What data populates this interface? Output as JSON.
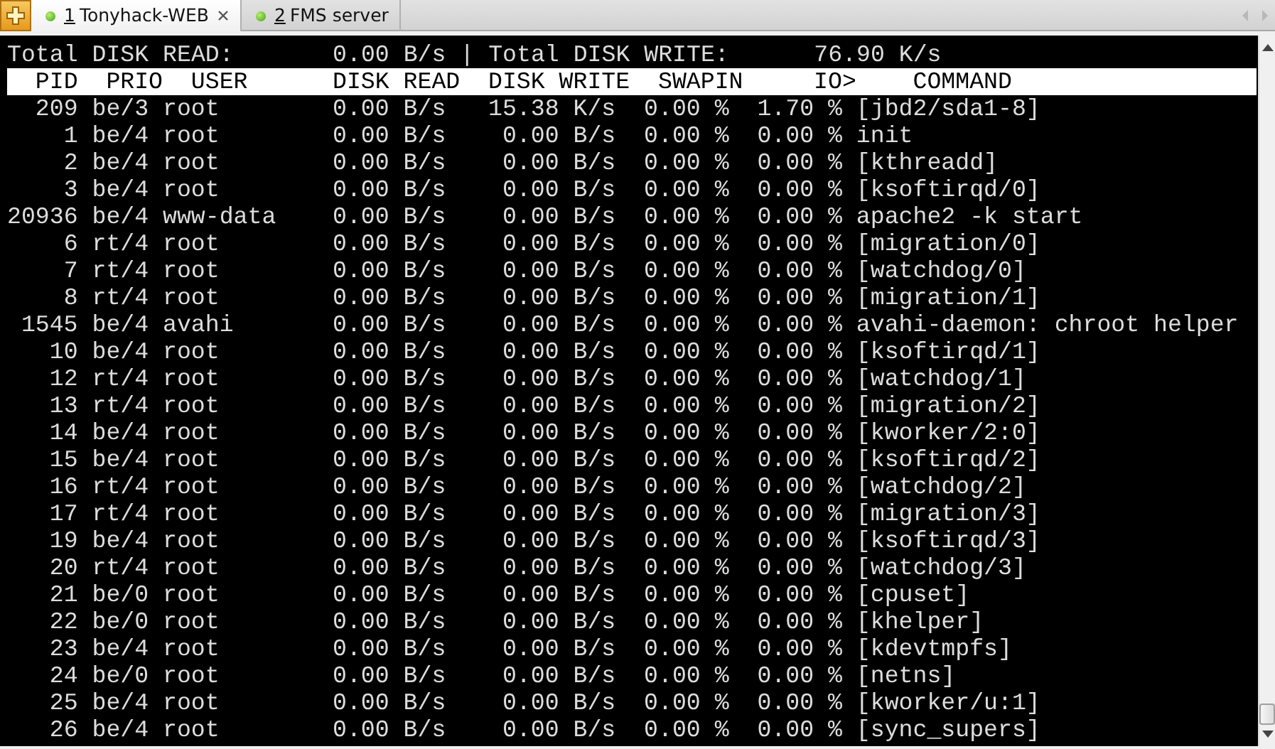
{
  "tabs": [
    {
      "number": "1",
      "label": "Tonyhack-WEB",
      "selected": true
    },
    {
      "number": "2",
      "label": "FMS server",
      "selected": false
    }
  ],
  "summary": {
    "read_label": "Total DISK READ:",
    "read_value": "0.00 B/s",
    "separator": "|",
    "write_label": "Total DISK WRITE:",
    "write_value": "76.90 K/s"
  },
  "columns": [
    "PID",
    "PRIO",
    "USER",
    "DISK READ",
    "DISK WRITE",
    "SWAPIN",
    "IO>",
    "COMMAND"
  ],
  "rows": [
    [
      "209",
      "be/3",
      "root",
      "0.00 B/s",
      "15.38 K/s",
      "0.00 %",
      "1.70 %",
      "[jbd2/sda1-8]"
    ],
    [
      "1",
      "be/4",
      "root",
      "0.00 B/s",
      "0.00 B/s",
      "0.00 %",
      "0.00 %",
      "init"
    ],
    [
      "2",
      "be/4",
      "root",
      "0.00 B/s",
      "0.00 B/s",
      "0.00 %",
      "0.00 %",
      "[kthreadd]"
    ],
    [
      "3",
      "be/4",
      "root",
      "0.00 B/s",
      "0.00 B/s",
      "0.00 %",
      "0.00 %",
      "[ksoftirqd/0]"
    ],
    [
      "20936",
      "be/4",
      "www-data",
      "0.00 B/s",
      "0.00 B/s",
      "0.00 %",
      "0.00 %",
      "apache2 -k start"
    ],
    [
      "6",
      "rt/4",
      "root",
      "0.00 B/s",
      "0.00 B/s",
      "0.00 %",
      "0.00 %",
      "[migration/0]"
    ],
    [
      "7",
      "rt/4",
      "root",
      "0.00 B/s",
      "0.00 B/s",
      "0.00 %",
      "0.00 %",
      "[watchdog/0]"
    ],
    [
      "8",
      "rt/4",
      "root",
      "0.00 B/s",
      "0.00 B/s",
      "0.00 %",
      "0.00 %",
      "[migration/1]"
    ],
    [
      "1545",
      "be/4",
      "avahi",
      "0.00 B/s",
      "0.00 B/s",
      "0.00 %",
      "0.00 %",
      "avahi-daemon: chroot helper"
    ],
    [
      "10",
      "be/4",
      "root",
      "0.00 B/s",
      "0.00 B/s",
      "0.00 %",
      "0.00 %",
      "[ksoftirqd/1]"
    ],
    [
      "12",
      "rt/4",
      "root",
      "0.00 B/s",
      "0.00 B/s",
      "0.00 %",
      "0.00 %",
      "[watchdog/1]"
    ],
    [
      "13",
      "rt/4",
      "root",
      "0.00 B/s",
      "0.00 B/s",
      "0.00 %",
      "0.00 %",
      "[migration/2]"
    ],
    [
      "14",
      "be/4",
      "root",
      "0.00 B/s",
      "0.00 B/s",
      "0.00 %",
      "0.00 %",
      "[kworker/2:0]"
    ],
    [
      "15",
      "be/4",
      "root",
      "0.00 B/s",
      "0.00 B/s",
      "0.00 %",
      "0.00 %",
      "[ksoftirqd/2]"
    ],
    [
      "16",
      "rt/4",
      "root",
      "0.00 B/s",
      "0.00 B/s",
      "0.00 %",
      "0.00 %",
      "[watchdog/2]"
    ],
    [
      "17",
      "rt/4",
      "root",
      "0.00 B/s",
      "0.00 B/s",
      "0.00 %",
      "0.00 %",
      "[migration/3]"
    ],
    [
      "19",
      "be/4",
      "root",
      "0.00 B/s",
      "0.00 B/s",
      "0.00 %",
      "0.00 %",
      "[ksoftirqd/3]"
    ],
    [
      "20",
      "rt/4",
      "root",
      "0.00 B/s",
      "0.00 B/s",
      "0.00 %",
      "0.00 %",
      "[watchdog/3]"
    ],
    [
      "21",
      "be/0",
      "root",
      "0.00 B/s",
      "0.00 B/s",
      "0.00 %",
      "0.00 %",
      "[cpuset]"
    ],
    [
      "22",
      "be/0",
      "root",
      "0.00 B/s",
      "0.00 B/s",
      "0.00 %",
      "0.00 %",
      "[khelper]"
    ],
    [
      "23",
      "be/4",
      "root",
      "0.00 B/s",
      "0.00 B/s",
      "0.00 %",
      "0.00 %",
      "[kdevtmpfs]"
    ],
    [
      "24",
      "be/0",
      "root",
      "0.00 B/s",
      "0.00 B/s",
      "0.00 %",
      "0.00 %",
      "[netns]"
    ],
    [
      "25",
      "be/4",
      "root",
      "0.00 B/s",
      "0.00 B/s",
      "0.00 %",
      "0.00 %",
      "[kworker/u:1]"
    ],
    [
      "26",
      "be/4",
      "root",
      "0.00 B/s",
      "0.00 B/s",
      "0.00 %",
      "0.00 %",
      "[sync_supers]"
    ]
  ]
}
